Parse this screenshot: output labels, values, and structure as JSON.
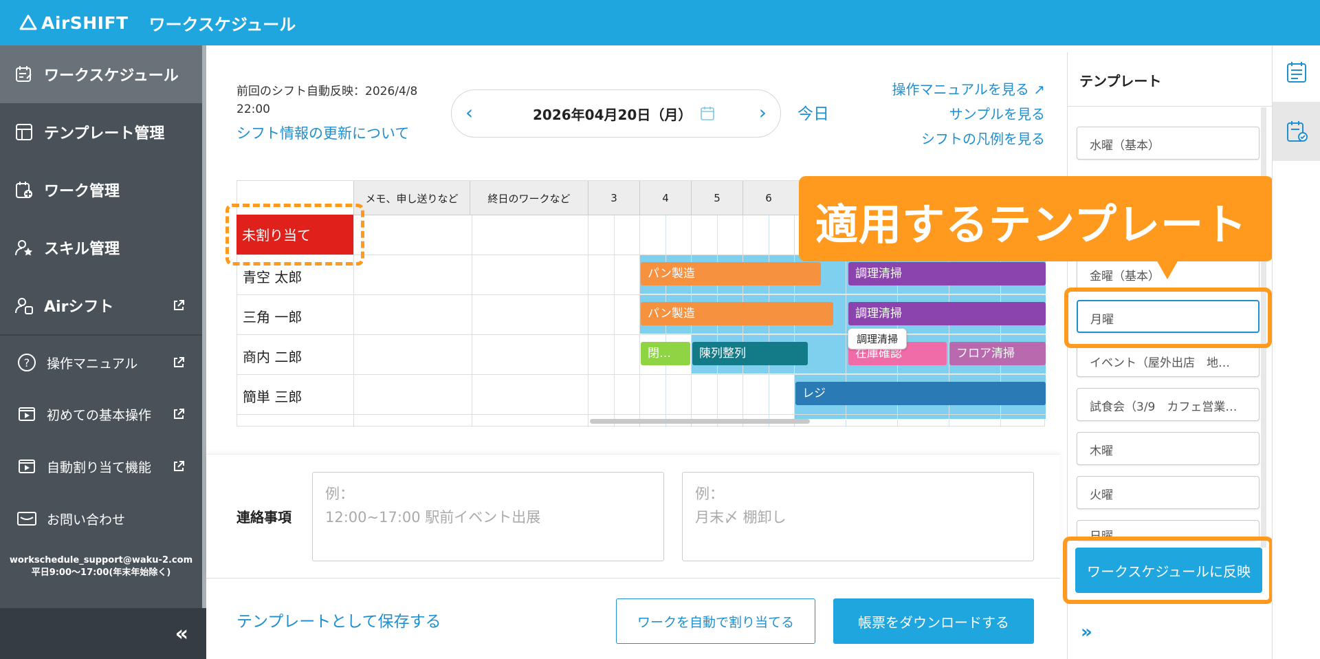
{
  "header": {
    "logo_text": "AirSHIFT",
    "app_title": "ワークスケジュール"
  },
  "sidebar": {
    "items": [
      {
        "label": "ワークスケジュール",
        "icon": "schedule-icon",
        "active": true
      },
      {
        "label": "テンプレート管理",
        "icon": "template-icon"
      },
      {
        "label": "ワーク管理",
        "icon": "work-add-icon"
      },
      {
        "label": "スキル管理",
        "icon": "skill-icon"
      },
      {
        "label": "Airシフト",
        "icon": "airshift-icon",
        "external": true
      }
    ],
    "sub_items": [
      {
        "label": "操作マニュアル",
        "icon": "help-icon",
        "external": true
      },
      {
        "label": "初めての基本操作",
        "icon": "video-icon",
        "external": true
      },
      {
        "label": "自動割り当て機能",
        "icon": "video-icon",
        "external": true
      },
      {
        "label": "お問い合わせ",
        "icon": "mail-icon"
      }
    ],
    "support_email": "workschedule_support@waku-2.com",
    "support_hours": "平日9:00〜17:00(年末年始除く)"
  },
  "main": {
    "last_reflect_label": "前回のシフト自動反映：2026/4/8",
    "last_reflect_time": "22:00",
    "update_link": "シフト情報の更新について",
    "date": "2026年04月20日（月）",
    "today": "今日",
    "links": [
      "操作マニュアルを見る",
      "サンプルを見る",
      "シフトの凡例を見る"
    ]
  },
  "grid": {
    "col_memo": "メモ、申し送りなど",
    "col_allday": "終日のワークなど",
    "hours": [
      "3",
      "4",
      "5",
      "6"
    ],
    "unassigned": "未割り当て",
    "rows": [
      "青空 太郎",
      "三角 一郎",
      "商内 二郎",
      "簡単 三郎"
    ],
    "tasks": {
      "bread1": "パン製造",
      "clean1": "調理清掃",
      "bread2": "パン製造",
      "clean2": "調理清掃",
      "close": "閉…",
      "display": "陳列整列",
      "stock": "在庫確認",
      "floor": "フロア清掃",
      "register": "レジ"
    },
    "tooltip": "調理清掃"
  },
  "notes": {
    "label": "連絡事項",
    "box1": "例：\n12:00~17:00 駅前イベント出展",
    "box2": "例：\n月末〆 棚卸し"
  },
  "actions": {
    "save_template": "テンプレートとして保存する",
    "auto_assign": "ワークを自動で割り当てる",
    "download": "帳票をダウンロードする"
  },
  "template_panel": {
    "title": "テンプレート",
    "items": [
      "水曜（基本）",
      "金曜（基本）",
      "月曜",
      "イベント（屋外出店　地…",
      "試食会（3/9　カフェ営業…",
      "木曜",
      "火曜",
      "日曜"
    ],
    "selected": "月曜",
    "apply": "ワークスケジュールに反映"
  },
  "callout": "適用するテンプレート",
  "colors": {
    "header": "#1fa6df",
    "sidebar": "#4a5259",
    "accent": "#1f8fcf",
    "highlight": "#ff9a1e",
    "unassigned": "#e0201a",
    "task_orange": "#f6913f",
    "task_purple": "#8b44ad",
    "task_green": "#8ed443",
    "task_teal": "#137a87",
    "task_pink": "#f06ca8",
    "task_mauve": "#b96aae",
    "task_blue": "#2a7ab5",
    "availability": "#7fd0ee"
  }
}
